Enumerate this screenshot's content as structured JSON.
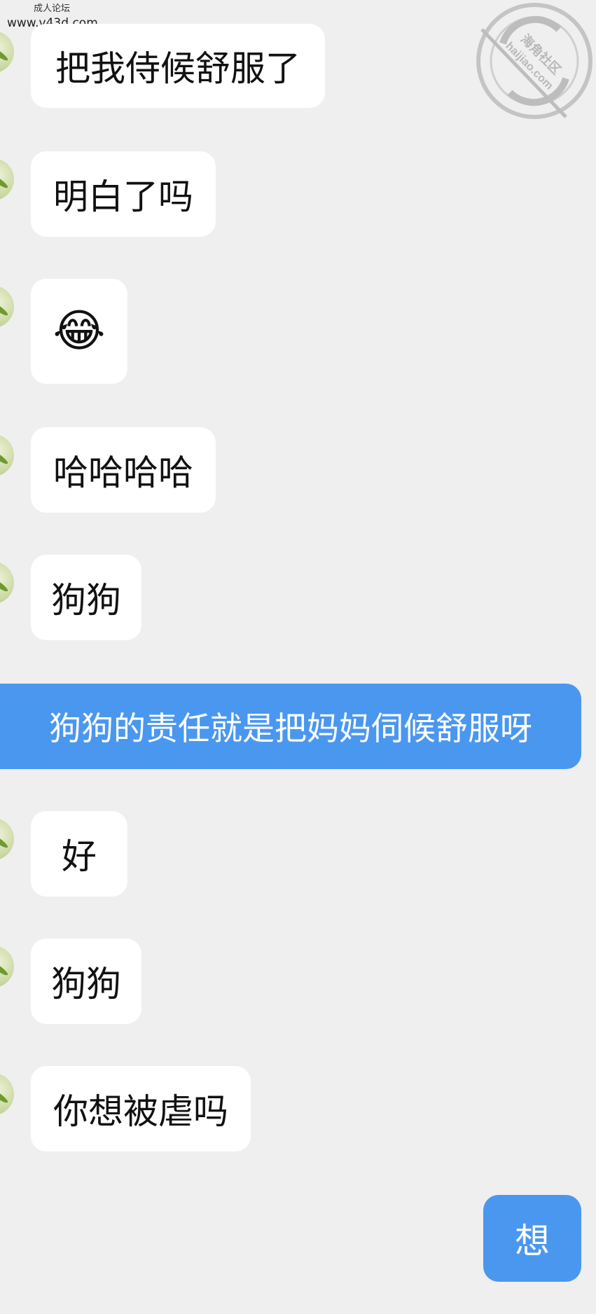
{
  "watermark": {
    "line1": "成人论坛",
    "line2": "www.v43d.com",
    "seal_text_top": "海角社区",
    "seal_text_bottom": "haijiao.com"
  },
  "messages": [
    {
      "side": "left",
      "text": "把我侍候舒服了"
    },
    {
      "side": "left",
      "text": "明白了吗"
    },
    {
      "side": "left",
      "text": "😂"
    },
    {
      "side": "left",
      "text": "哈哈哈哈"
    },
    {
      "side": "left",
      "text": "狗狗"
    },
    {
      "side": "right",
      "text": "狗狗的责任就是把妈妈伺候舒服呀"
    },
    {
      "side": "left",
      "text": "好"
    },
    {
      "side": "left",
      "text": "狗狗"
    },
    {
      "side": "left",
      "text": "你想被虐吗"
    },
    {
      "side": "right",
      "text": "想"
    }
  ],
  "colors": {
    "background": "#efefef",
    "incoming_bubble": "#ffffff",
    "outgoing_bubble": "#4a97f0"
  }
}
